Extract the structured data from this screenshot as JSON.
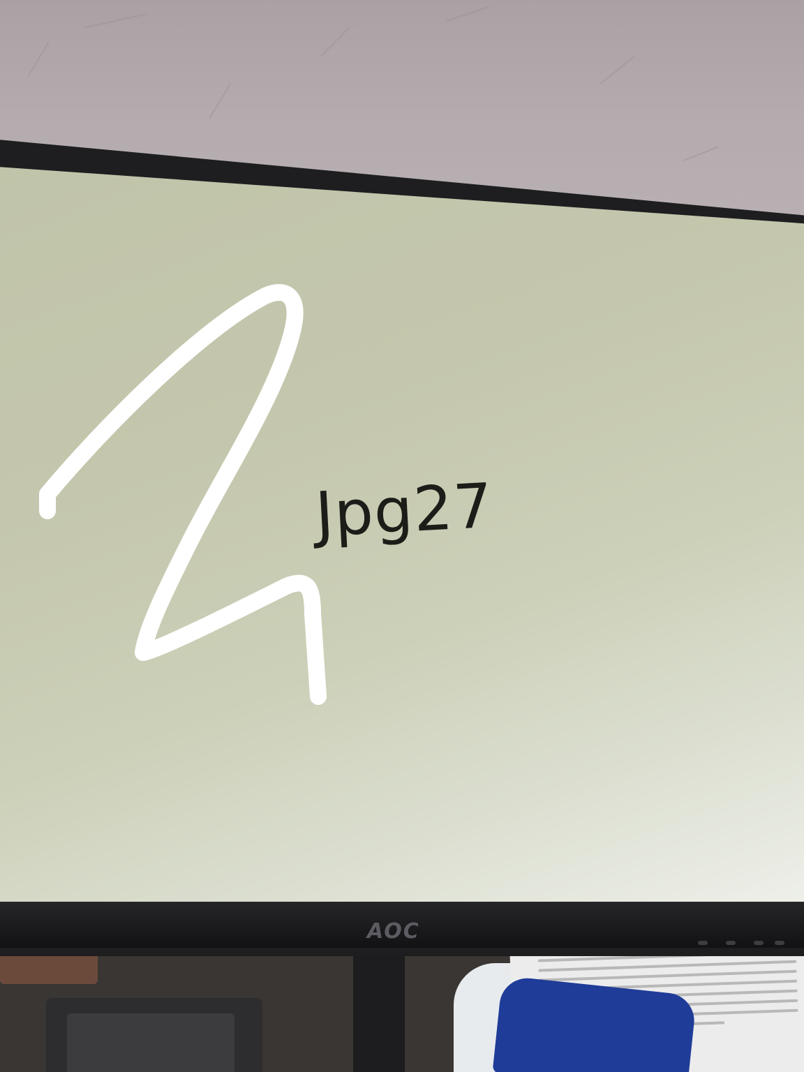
{
  "screen": {
    "text": "Jpg27",
    "background_color": "#c4c7ad",
    "text_color": "#1c1d18"
  },
  "scribble": {
    "color": "#ffffff",
    "description_icon": "handwritten-stroke"
  },
  "monitor": {
    "brand_logo": "AOC",
    "bezel_color": "#1e1e20"
  },
  "environment": {
    "ceiling_color": "#b3abad",
    "desk_color": "#3a3633",
    "pouch_color": "#1f3c98"
  }
}
